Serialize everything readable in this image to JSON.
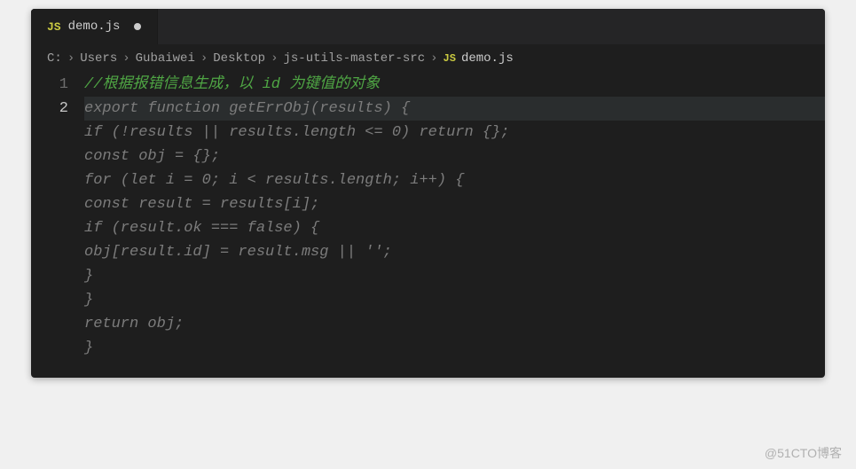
{
  "tab": {
    "icon_label": "JS",
    "filename": "demo.js",
    "modified": true
  },
  "breadcrumb": {
    "parts": [
      "C:",
      "Users",
      "Gubaiwei",
      "Desktop",
      "js-utils-master-src"
    ],
    "file_icon": "JS",
    "file": "demo.js"
  },
  "gutter": {
    "ln1": "1",
    "ln2": "2"
  },
  "code": {
    "l1": "//根据报错信息生成，以 id 为键值的对象",
    "l2": "export function getErrObj(results) {",
    "l3": "    if (!results || results.length <= 0) return {};",
    "l4": "",
    "l5": "    const obj = {};",
    "l6": "    for (let i = 0; i < results.length; i++) {",
    "l7": "        const result = results[i];",
    "l8": "        if (result.ok === false) {",
    "l9": "            obj[result.id] = result.msg || '';",
    "l10": "        }",
    "l11": "    }",
    "l12": "    return obj;",
    "l13": "}"
  },
  "watermark": "@51CTO博客"
}
